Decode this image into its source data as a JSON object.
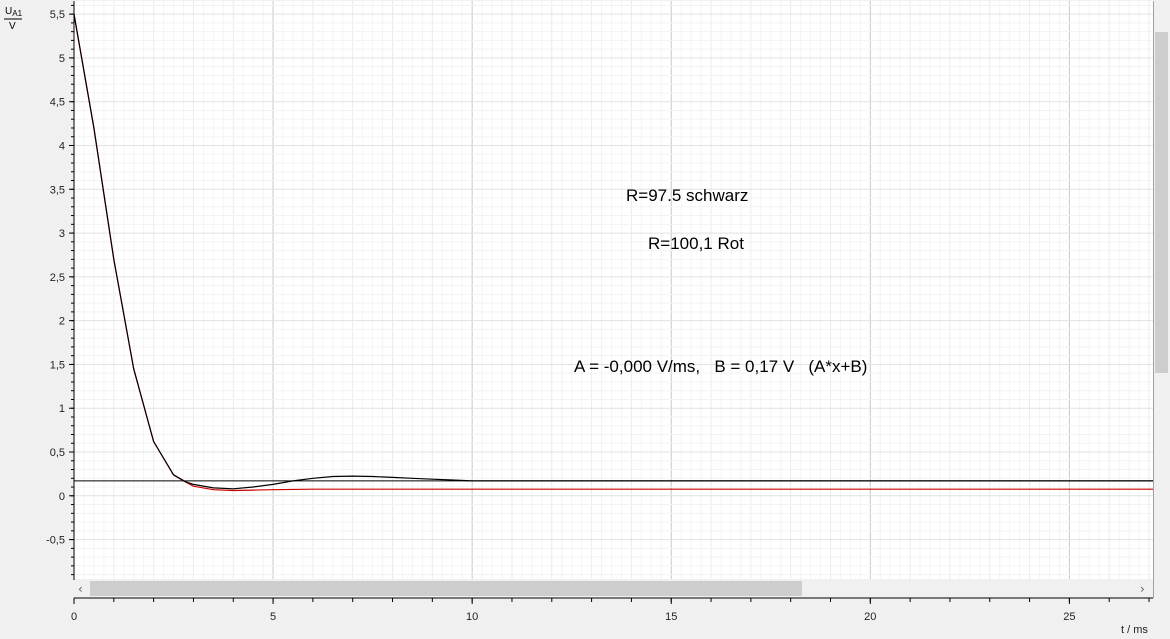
{
  "chart_data": {
    "type": "line",
    "ylabel": "U_A1",
    "ylabel_sub": "A1",
    "ylabel_main": "U",
    "yunit": "V",
    "xlabel": "t / ms",
    "xlim": [
      0,
      27.1
    ],
    "ylim": [
      -0.95,
      5.65
    ],
    "x_ticks": [
      "0",
      "5",
      "10",
      "15",
      "20",
      "25"
    ],
    "x_tick_values": [
      0,
      5,
      10,
      15,
      20,
      25
    ],
    "y_ticks": [
      "-0,5",
      "0",
      "0,5",
      "1",
      "1,5",
      "2",
      "2,5",
      "3",
      "3,5",
      "4",
      "4,5",
      "5",
      "5,5"
    ],
    "y_tick_values": [
      -0.5,
      0,
      0.5,
      1,
      1.5,
      2,
      2.5,
      3,
      3.5,
      4,
      4.5,
      5,
      5.5
    ],
    "grid": true,
    "series": [
      {
        "color": "#000000",
        "x": [
          0,
          0.5,
          1,
          1.5,
          2,
          2.5,
          2.8,
          3,
          3.5,
          4,
          4.5,
          5,
          5.5,
          6,
          6.5,
          7,
          7.5,
          8,
          8.5,
          9,
          9.5,
          10,
          11,
          12,
          13,
          14,
          15,
          16,
          18,
          20,
          22,
          25,
          27.1
        ],
        "y": [
          5.5,
          4.2,
          2.7,
          1.45,
          0.62,
          0.24,
          0.16,
          0.13,
          0.09,
          0.08,
          0.1,
          0.13,
          0.17,
          0.2,
          0.22,
          0.225,
          0.22,
          0.21,
          0.2,
          0.19,
          0.18,
          0.17,
          0.17,
          0.17,
          0.17,
          0.17,
          0.17,
          0.17,
          0.17,
          0.17,
          0.17,
          0.17,
          0.17
        ]
      },
      {
        "color": "#cc0000",
        "x": [
          0,
          0.5,
          1,
          1.5,
          2,
          2.5,
          2.8,
          3,
          3.5,
          4,
          4.5,
          5,
          6,
          7,
          8,
          10,
          15,
          20,
          27.1
        ],
        "y": [
          5.5,
          4.2,
          2.7,
          1.45,
          0.62,
          0.24,
          0.16,
          0.11,
          0.07,
          0.06,
          0.065,
          0.07,
          0.075,
          0.075,
          0.075,
          0.075,
          0.075,
          0.075,
          0.075
        ]
      }
    ],
    "fit_line": {
      "color": "#000000",
      "y": 0.17
    },
    "annotations": [
      "R=97.5 schwarz",
      "R=100,1 Rot",
      "A = -0,000 V/ms,   B = 0,17 V   (A*x+B)"
    ]
  }
}
